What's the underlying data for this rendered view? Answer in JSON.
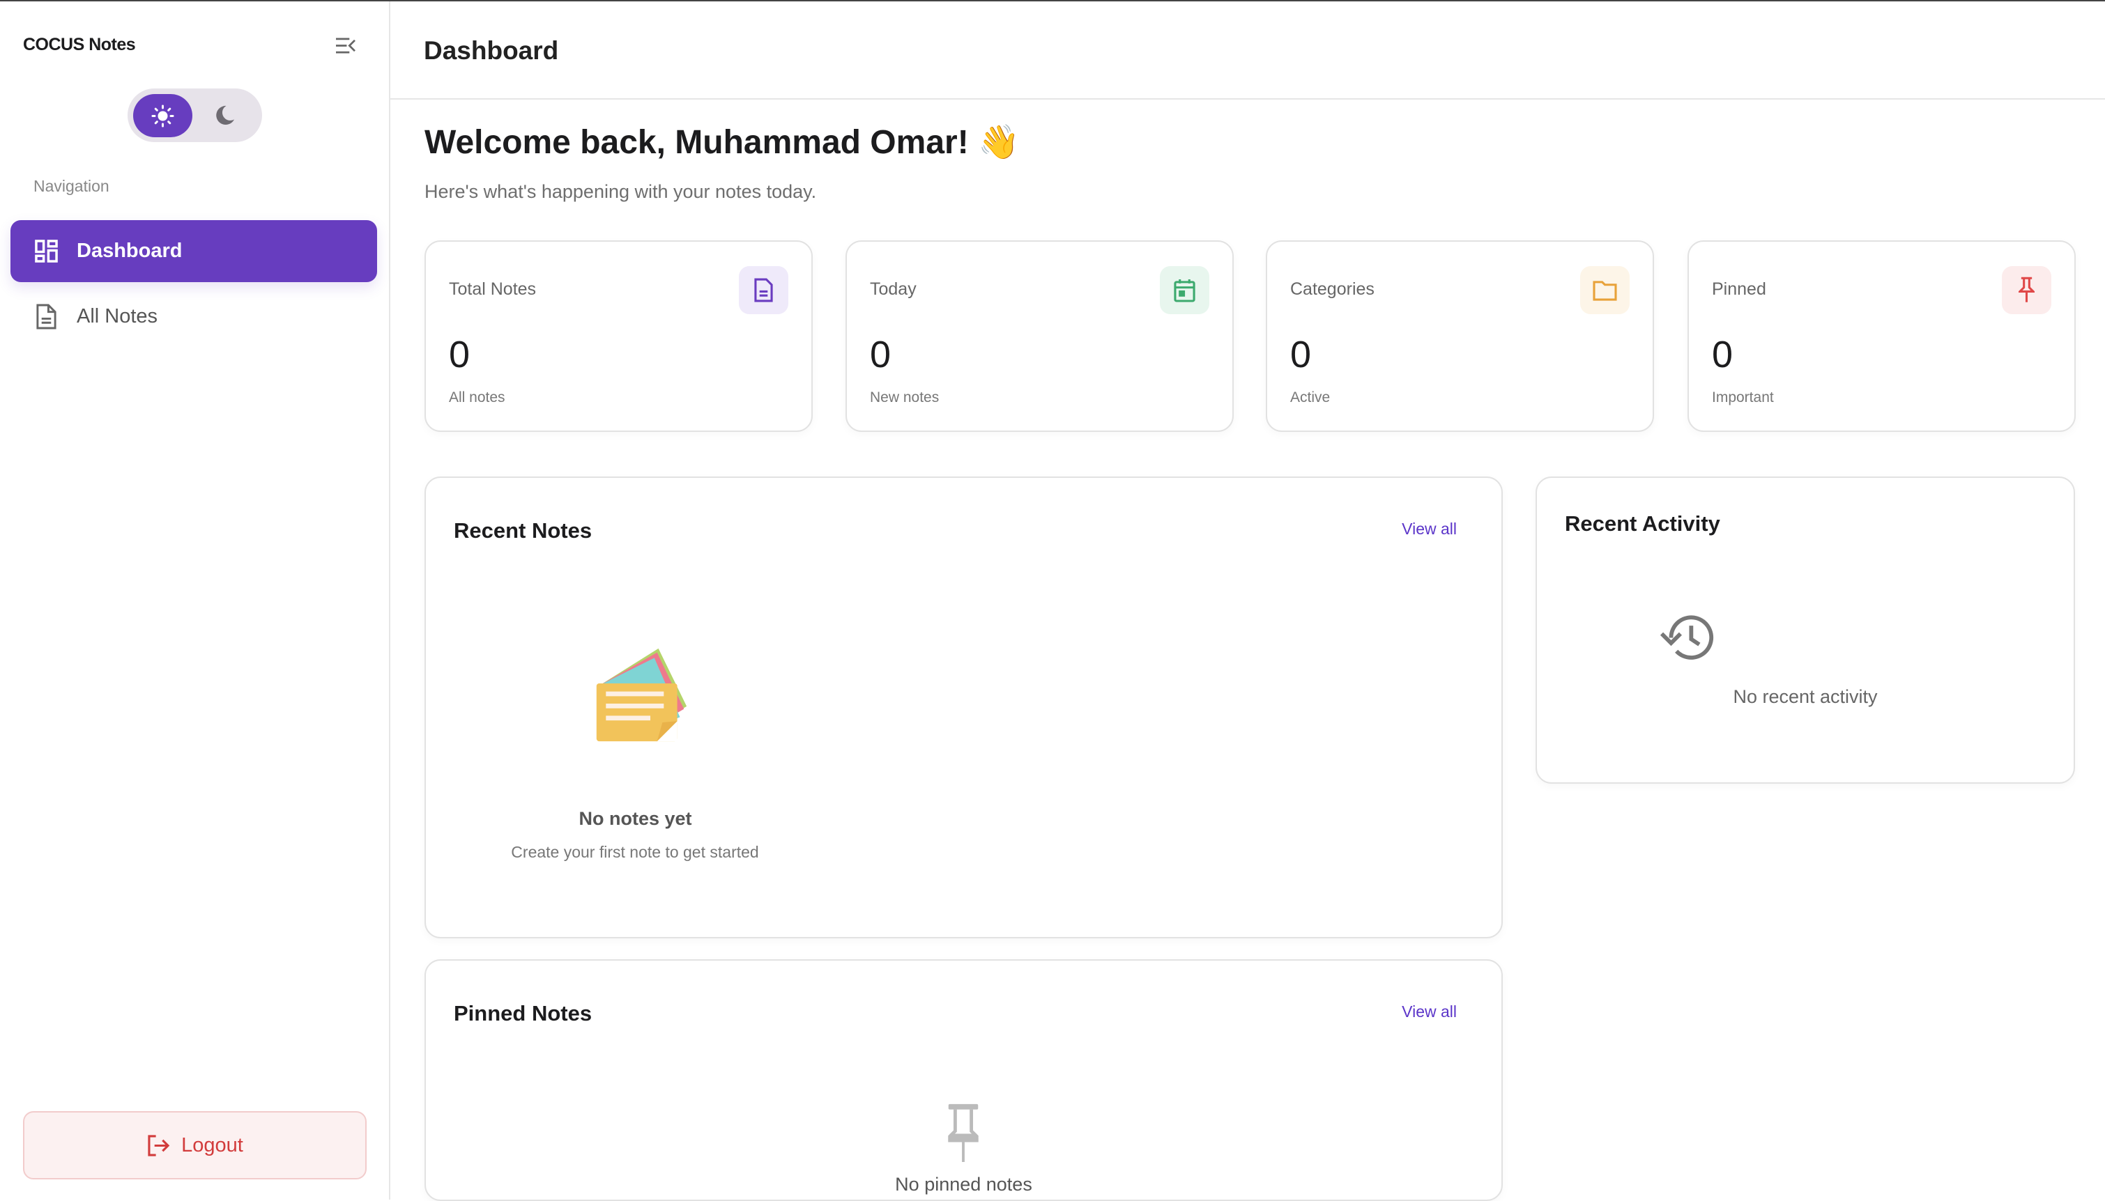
{
  "app": {
    "title": "COCUS Notes"
  },
  "theme": {
    "mode": "light",
    "accent": "#673dbf"
  },
  "sidebar": {
    "section_label": "Navigation",
    "items": [
      {
        "label": "Dashboard",
        "icon": "dashboard-icon",
        "active": true
      },
      {
        "label": "All Notes",
        "icon": "document-icon",
        "active": false
      }
    ],
    "logout_label": "Logout"
  },
  "header": {
    "title": "Dashboard"
  },
  "welcome": {
    "title": "Welcome back, Muhammad Omar! 👋",
    "subtitle": "Here's what's happening with your notes today."
  },
  "stats": [
    {
      "label": "Total Notes",
      "value": "0",
      "caption": "All notes",
      "icon": "document-icon",
      "color": "#6a3cc0"
    },
    {
      "label": "Today",
      "value": "0",
      "caption": "New notes",
      "icon": "calendar-icon",
      "color": "#3daa6e"
    },
    {
      "label": "Categories",
      "value": "0",
      "caption": "Active",
      "icon": "folder-icon",
      "color": "#e8a23a"
    },
    {
      "label": "Pinned",
      "value": "0",
      "caption": "Important",
      "icon": "pin-icon",
      "color": "#e04848"
    }
  ],
  "recent_notes": {
    "title": "Recent Notes",
    "view_all": "View all",
    "empty_title": "No notes yet",
    "empty_subtitle": "Create your first note to get started"
  },
  "recent_activity": {
    "title": "Recent Activity",
    "empty_text": "No recent activity"
  },
  "pinned_notes": {
    "title": "Pinned Notes",
    "view_all": "View all",
    "empty_title": "No pinned notes"
  }
}
